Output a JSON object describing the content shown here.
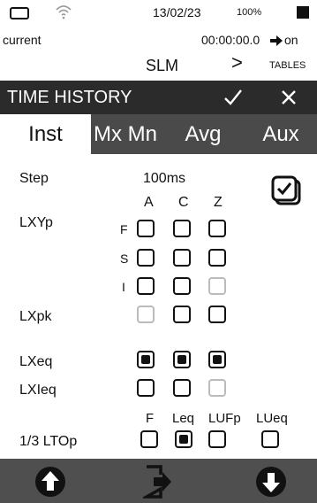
{
  "status_bar": {
    "date": "13/02/23",
    "battery_percent": "100%"
  },
  "info": {
    "mode": "current",
    "timer": "00:00:00.0",
    "timer_state": "on"
  },
  "nav": {
    "title": "SLM",
    "next_symbol": ">",
    "next_label": "TABLES"
  },
  "header": {
    "title": "TIME HISTORY"
  },
  "tabs": [
    {
      "label": "Inst",
      "active": true
    },
    {
      "label": "Mx Mn",
      "active": false
    },
    {
      "label": "Avg",
      "active": false
    },
    {
      "label": "Aux",
      "active": false
    }
  ],
  "step": {
    "label": "Step",
    "value": "100ms"
  },
  "weighting_columns": [
    "A",
    "C",
    "Z"
  ],
  "rows": {
    "lxyp": {
      "label": "LXYp",
      "sub": [
        {
          "label": "F",
          "states": [
            "off",
            "off",
            "off"
          ]
        },
        {
          "label": "S",
          "states": [
            "off",
            "off",
            "off"
          ]
        },
        {
          "label": "I",
          "states": [
            "off",
            "off",
            "disabled"
          ]
        }
      ]
    },
    "lxpk": {
      "label": "LXpk",
      "states": [
        "disabled",
        "off",
        "off"
      ]
    },
    "lxeq": {
      "label": "LXeq",
      "states": [
        "on",
        "on",
        "on"
      ]
    },
    "lxieq": {
      "label": "LXIeq",
      "states": [
        "off",
        "off",
        "disabled"
      ]
    }
  },
  "lto": {
    "label": "1/3 LTOp",
    "columns": [
      "F",
      "Leq",
      "LUFp",
      "LUeq"
    ],
    "states": [
      "off",
      "on",
      "off",
      "off"
    ]
  },
  "colors": {
    "header_bg": "#2b2b2b",
    "tab_bg": "#4a4a4a",
    "footer_bg": "#4f4f4f",
    "checkbox_disabled": "#bbbbbb"
  }
}
